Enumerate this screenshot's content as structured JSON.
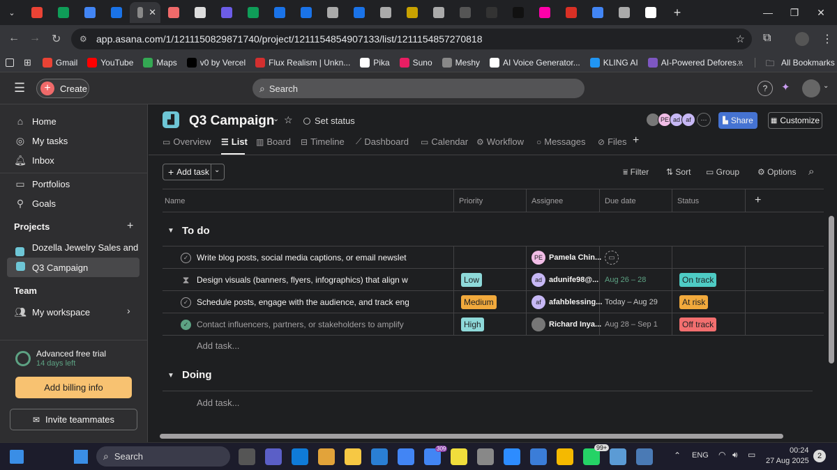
{
  "browser": {
    "tabs_icon_colors": [
      "#ea4335",
      "#0f9d58",
      "#4285f4",
      "#1a73e8",
      "#888888",
      "#f06a6a",
      "#dddddd",
      "#6c5ce7",
      "#0f9d58",
      "#1a73e8",
      "#1a73e8",
      "#aaaaaa",
      "#1a73e8",
      "#aaaaaa",
      "#c8a200",
      "#aaaaaa",
      "#555555",
      "#333333",
      "#111111",
      "#f0a",
      "#d93025",
      "#4285f4",
      "#aaaaaa",
      "#ffffff"
    ],
    "url": "app.asana.com/1/1211150829871740/project/1211154854907133/list/1211154857270818",
    "new_tab": "+",
    "bookmarks": [
      {
        "label": "Gmail",
        "color": "#ea4335"
      },
      {
        "label": "YouTube",
        "color": "#ff0000"
      },
      {
        "label": "Maps",
        "color": "#34a853"
      },
      {
        "label": "v0 by Vercel",
        "color": "#000000"
      },
      {
        "label": "Flux Realism | Unkn...",
        "color": "#d32f2f"
      },
      {
        "label": "Pika",
        "color": "#ffffff"
      },
      {
        "label": "Suno",
        "color": "#e91e63"
      },
      {
        "label": "Meshy",
        "color": "#888888"
      },
      {
        "label": "AI Voice Generator...",
        "color": "#ffffff"
      },
      {
        "label": "KLING AI",
        "color": "#2196f3"
      },
      {
        "label": "AI-Powered Defores...",
        "color": "#7e57c2"
      }
    ],
    "bookmarks_more": "»",
    "all_bookmarks": "All Bookmarks"
  },
  "asana": {
    "create": "Create",
    "search_placeholder": "Search",
    "sidebar": {
      "home": "Home",
      "my_tasks": "My tasks",
      "inbox": "Inbox",
      "portfolios": "Portfolios",
      "goals": "Goals",
      "projects_header": "Projects",
      "projects": [
        {
          "label": "Dozella Jewelry Sales and ...",
          "color": "#6ec6d6"
        },
        {
          "label": "Q3 Campaign",
          "color": "#6ec6d6"
        }
      ],
      "team_header": "Team",
      "my_workspace": "My workspace",
      "trial_title": "Advanced free trial",
      "trial_days": "14 days left",
      "billing_button": "Add billing info",
      "invite_button": "Invite teammates"
    },
    "project": {
      "title": "Q3 Campaign",
      "set_status": "Set status",
      "share": "Share",
      "customize": "Customize",
      "members": [
        {
          "initials": "",
          "color": "#777777"
        },
        {
          "initials": "PE",
          "color": "#f1bde6"
        },
        {
          "initials": "ad",
          "color": "#c7b8f5"
        },
        {
          "initials": "af",
          "color": "#c7b8f5"
        }
      ],
      "members_more": "···",
      "tabs": [
        "Overview",
        "List",
        "Board",
        "Timeline",
        "Dashboard",
        "Calendar",
        "Workflow",
        "Messages",
        "Files"
      ],
      "add_tab": "+"
    },
    "toolbar": {
      "add_task": "Add task",
      "filter": "Filter",
      "sort": "Sort",
      "group": "Group",
      "options": "Options"
    },
    "columns": [
      "Name",
      "Priority",
      "Assignee",
      "Due date",
      "Status"
    ],
    "add_column": "+",
    "sections": [
      {
        "name": "To do",
        "tasks": [
          {
            "name": "Write blog posts, social media captions, or email newslet",
            "priority": "",
            "priority_color": "",
            "assignee": "Pamela Chin...",
            "assignee_initials": "PE",
            "assignee_color": "#f1bde6",
            "due": "",
            "status": "",
            "status_color": "",
            "done": false,
            "icon": "check"
          },
          {
            "name": "Design visuals (banners, flyers, infographics) that align w",
            "priority": "Low",
            "priority_color": "#8ed9d9",
            "assignee": "adunife98@...",
            "assignee_initials": "ad",
            "assignee_color": "#c7b8f5",
            "due": "Aug 26 – 28",
            "status": "On track",
            "status_color": "#4ecbc4",
            "done": false,
            "icon": "hourglass"
          },
          {
            "name": "Schedule posts, engage with the audience, and track eng",
            "priority": "Medium",
            "priority_color": "#f1a93c",
            "assignee": "afahblessing...",
            "assignee_initials": "af",
            "assignee_color": "#c7b8f5",
            "due": "Today – Aug 29",
            "status": "At risk",
            "status_color": "#f1a93c",
            "done": false,
            "icon": "check"
          },
          {
            "name": "Contact influencers, partners, or stakeholders to amplify",
            "priority": "High",
            "priority_color": "#8ed9d9",
            "assignee": "Richard Inya...",
            "assignee_initials": "",
            "assignee_color": "#777777",
            "due": "Aug 28 – Sep 1",
            "status": "Off track",
            "status_color": "#f26f6f",
            "done": true,
            "icon": "check"
          }
        ],
        "add_task": "Add task..."
      },
      {
        "name": "Doing",
        "tasks": [],
        "add_task": "Add task..."
      }
    ]
  },
  "taskbar": {
    "search": "Search",
    "lang": "ENG",
    "time": "00:24",
    "date": "27 Aug 2025",
    "badge_mail": "99+",
    "badge_chrome": "309",
    "notif": "2"
  }
}
